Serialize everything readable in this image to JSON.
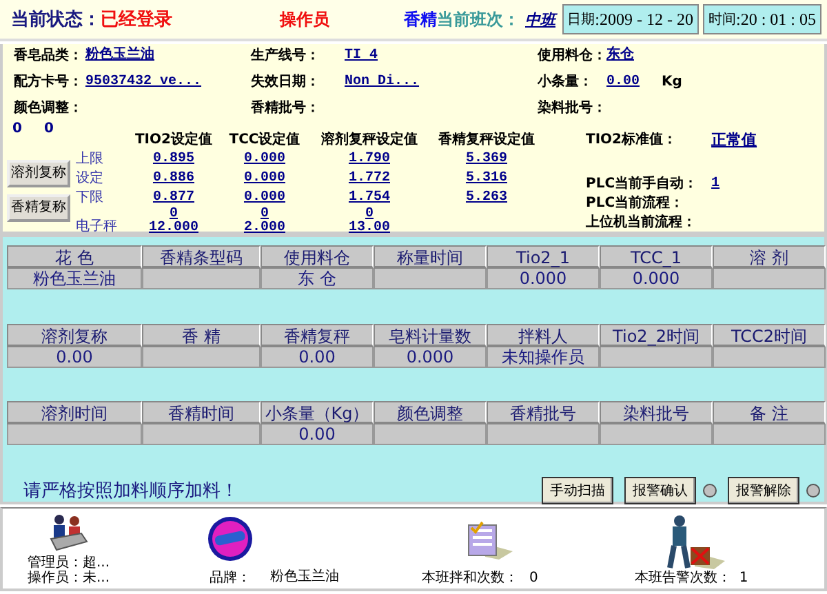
{
  "header": {
    "status_label": "当前状态：",
    "status": "已经登录",
    "operator": "操作员",
    "flavor": "香精",
    "shift_label": "当前班次：",
    "shift": "中班",
    "date_label": "日期",
    "date": ":2009 - 12 - 20",
    "time_label": "时间",
    "time": ":20 : 01 : 05"
  },
  "info": {
    "fields": [
      {
        "label": "香皂品类：",
        "value": "粉色玉兰油"
      },
      {
        "label": "生产线号：",
        "value": "TI 4"
      },
      {
        "label": "使用料仓：",
        "value": "东仓"
      },
      {
        "label": "配方卡号：",
        "value": "95037432 ve..."
      },
      {
        "label": "失效日期：",
        "value": "Non Di..."
      },
      {
        "label": "小条量：",
        "value": "0.00",
        "unit": "Kg"
      },
      {
        "label": "颜色调整："
      },
      {
        "label": "香精批号："
      },
      {
        "label": "染料批号："
      }
    ]
  },
  "counters": [
    "0",
    "0"
  ],
  "side_buttons": [
    "溶剂复称",
    "香精复称"
  ],
  "setpoints": {
    "columns": [
      "TIO2设定值",
      "TCC设定值",
      "溶剂复秤设定值",
      "香精复秤设定值"
    ],
    "rows": [
      {
        "label": "上限",
        "values": [
          "0.895",
          "0.000",
          "1.790",
          "5.369"
        ]
      },
      {
        "label": "设定",
        "values": [
          "0.886",
          "0.000",
          "1.772",
          "5.316"
        ]
      },
      {
        "label": "下限",
        "values": [
          "0.877",
          "0.000",
          "1.754",
          "5.263"
        ]
      }
    ],
    "scale": {
      "label": "电子秤",
      "readings": [
        {
          "zero": "0",
          "value": "12.000"
        },
        {
          "zero": "0",
          "value": "2.000"
        },
        {
          "zero": "0",
          "value": "13.00"
        }
      ]
    }
  },
  "plc": [
    {
      "label": "TIO2标准值：",
      "value": "正常值"
    },
    {
      "label": "PLC当前手自动：",
      "value": "1"
    },
    {
      "label": "PLC当前流程："
    },
    {
      "label": "上位机当前流程："
    }
  ],
  "grids": [
    {
      "columns": [
        {
          "header": "花 色",
          "value": "粉色玉兰油"
        },
        {
          "header": "香精条型码"
        },
        {
          "header": "使用料仓",
          "value": "东 仓"
        },
        {
          "header": "称量时间"
        },
        {
          "header": "Tio2_1",
          "value": "0.000"
        },
        {
          "header": "TCC_1",
          "value": "0.000"
        },
        {
          "header": "溶 剂"
        }
      ]
    },
    {
      "columns": [
        {
          "header": "溶剂复称",
          "value": "0.00"
        },
        {
          "header": "香 精"
        },
        {
          "header": "香精复秤",
          "value": "0.00"
        },
        {
          "header": "皂料计量数",
          "value": "0.000"
        },
        {
          "header": "拌料人",
          "value": "未知操作员"
        },
        {
          "header": "Tio2_2时间"
        },
        {
          "header": "TCC2时间"
        }
      ]
    },
    {
      "columns": [
        {
          "header": "溶剂时间"
        },
        {
          "header": "香精时间"
        },
        {
          "header": "小条量（Kg）",
          "value": "0.00"
        },
        {
          "header": "颜色调整"
        },
        {
          "header": "香精批号"
        },
        {
          "header": "染料批号"
        },
        {
          "header": "备 注"
        }
      ]
    }
  ],
  "notice": "请严格按照加料顺序加料！",
  "actions": [
    {
      "label": "手动扫描"
    },
    {
      "label": "报警确认",
      "lamp": {
        "lit": false
      }
    },
    {
      "label": "报警解除",
      "lamp": {
        "lit": false
      }
    }
  ],
  "footer": {
    "users": [
      "管理员：超...",
      "操作员：未..."
    ],
    "brand_label": "品牌：",
    "brand": "粉色玉兰油",
    "mix_label": "本班拌和次数：",
    "mix_count": "0",
    "alarm_label": "本班告警次数：",
    "alarm_count": "1"
  }
}
